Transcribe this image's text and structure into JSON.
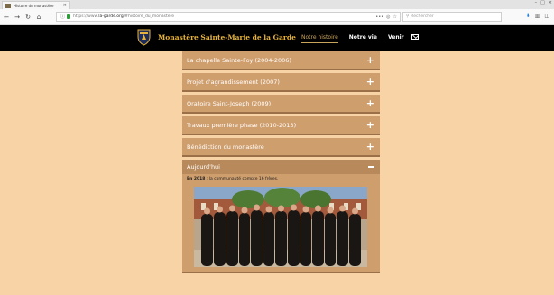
{
  "browser": {
    "tab_title": "Histoire du monastère",
    "tab_close": "×",
    "url_prefix": "https://www.",
    "url_domain": "la-garde.org",
    "url_path": "/#histoire_du_monastere",
    "url_more": "•••",
    "search_placeholder": "Rechercher",
    "window_controls": [
      "–",
      "□",
      "×"
    ]
  },
  "site": {
    "title": "Monastère Sainte-Marie de la Garde",
    "nav": [
      {
        "label": "Notre histoire",
        "active": true
      },
      {
        "label": "Notre vie",
        "active": false
      },
      {
        "label": "Venir",
        "active": false
      }
    ]
  },
  "accordion": {
    "items": [
      {
        "label": "La chapelle Sainte-Foy (2004-2006)",
        "toggle": "+"
      },
      {
        "label": "Projet d'agrandissement (2007)",
        "toggle": "+"
      },
      {
        "label": "Oratoire Saint-Joseph (2009)",
        "toggle": "+"
      },
      {
        "label": "Travaux première phase (2010-2013)",
        "toggle": "+"
      },
      {
        "label": "Bénédiction du monastère",
        "toggle": "+"
      }
    ],
    "open": {
      "label": "Aujourd'hui",
      "text_bold": "En 2018",
      "text_rest": " : la communauté compte 16 frères."
    }
  },
  "colors": {
    "page_bg": "#f7d3a6",
    "accordion_item": "#cf9e6d",
    "accordion_open_header": "#b88a5b",
    "header_bg": "#000000",
    "title_gold": "#e6b23a"
  }
}
